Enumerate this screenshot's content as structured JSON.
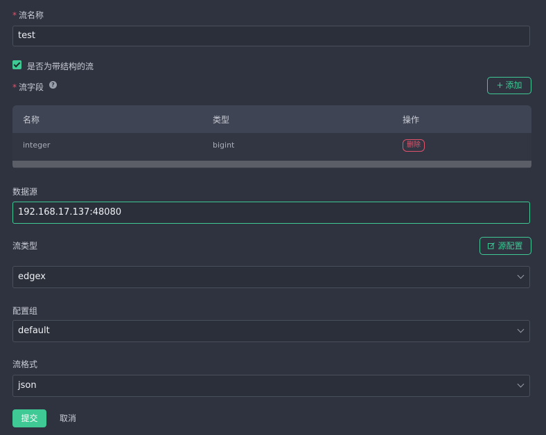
{
  "stream_name": {
    "label": "流名称",
    "required_mark": "*",
    "value": "test"
  },
  "structured_checkbox": {
    "label": "是否为带结构的流",
    "checked": true
  },
  "stream_fields": {
    "label": "流字段",
    "required_mark": "*",
    "help_icon": "?",
    "add_button": {
      "icon": "+",
      "label": "添加"
    },
    "columns": [
      "名称",
      "类型",
      "操作"
    ],
    "rows": [
      {
        "name": "integer",
        "type": "bigint",
        "action": "删除"
      }
    ]
  },
  "datasource": {
    "label": "数据源",
    "value": "192.168.17.137:48080"
  },
  "stream_type": {
    "label": "流类型",
    "value": "edgex",
    "config_button": {
      "icon": "edit-icon",
      "label": "源配置"
    }
  },
  "config_group": {
    "label": "配置组",
    "value": "default"
  },
  "stream_format": {
    "label": "流格式",
    "value": "json"
  },
  "actions": {
    "submit": "提交",
    "cancel": "取消"
  },
  "colors": {
    "accent": "#3fc995",
    "danger": "#e0536b",
    "background": "#2f3340"
  }
}
